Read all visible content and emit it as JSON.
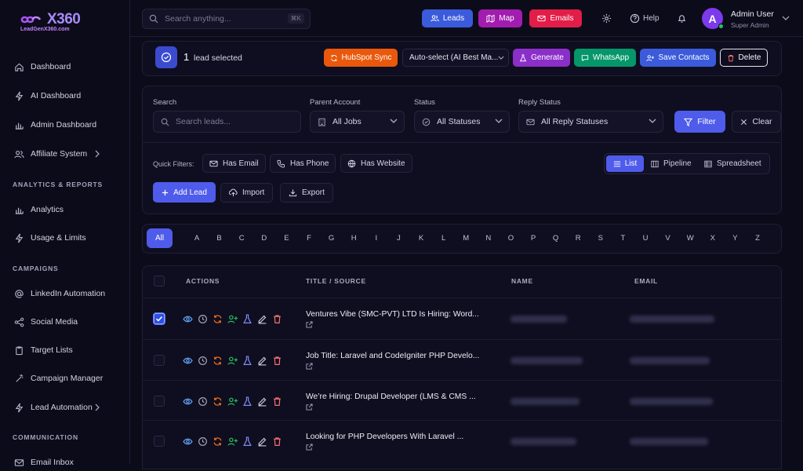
{
  "logo": {
    "wordmark": "X360",
    "subtitle": "LeadGenX360.com"
  },
  "sidebar": {
    "items_top": [
      {
        "label": "Dashboard",
        "icon": "home-icon"
      },
      {
        "label": "AI Dashboard",
        "icon": "sparkle-icon"
      },
      {
        "label": "Admin Dashboard",
        "icon": "bar-chart-icon"
      },
      {
        "label": "Affiliate System",
        "icon": "users-icon"
      }
    ],
    "section_analytics": "ANALYTICS & REPORTS",
    "items_analytics": [
      {
        "label": "Analytics",
        "icon": "bar-chart-icon"
      },
      {
        "label": "Usage & Limits",
        "icon": "bolt-icon"
      }
    ],
    "section_campaigns": "CAMPAIGNS",
    "items_campaigns": [
      {
        "label": "LinkedIn Automation",
        "icon": "at-icon"
      },
      {
        "label": "Social Media",
        "icon": "share-icon"
      },
      {
        "label": "Target Lists",
        "icon": "clipboard-icon"
      },
      {
        "label": "Campaign Manager",
        "icon": "wand-icon"
      },
      {
        "label": "Lead Automation",
        "icon": "bolt-icon"
      }
    ],
    "section_communication": "COMMUNICATION",
    "items_communication": [
      {
        "label": "Email Inbox",
        "icon": "mail-icon"
      }
    ]
  },
  "topbar": {
    "search_placeholder": "Search anything...",
    "shortcut": "⌘K",
    "leads": "Leads",
    "map": "Map",
    "emails": "Emails",
    "help": "Help",
    "user_name": "Admin User",
    "user_role": "Super Admin",
    "avatar_initial": "A"
  },
  "selection_bar": {
    "count": "1",
    "label": "lead selected",
    "hubspot": "HubSpot Sync",
    "auto_select": "Auto-select (AI Best Ma...",
    "generate": "Generate",
    "whatsapp": "WhatsApp",
    "save_contacts": "Save Contacts",
    "delete": "Delete"
  },
  "filters": {
    "search_label": "Search",
    "search_placeholder": "Search leads...",
    "parent_label": "Parent Account",
    "parent_value": "All Jobs",
    "status_label": "Status",
    "status_value": "All Statuses",
    "reply_label": "Reply Status",
    "reply_value": "All Reply Statuses",
    "filter_button": "Filter",
    "clear_button": "Clear",
    "quick_label": "Quick Filters:",
    "has_email": "Has Email",
    "has_phone": "Has Phone",
    "has_website": "Has Website",
    "view_list": "List",
    "view_pipeline": "Pipeline",
    "view_spreadsheet": "Spreadsheet",
    "add_lead": "Add Lead",
    "import": "Import",
    "export": "Export"
  },
  "alphabet": [
    "All",
    "A",
    "B",
    "C",
    "D",
    "E",
    "F",
    "G",
    "H",
    "I",
    "J",
    "K",
    "L",
    "M",
    "N",
    "O",
    "P",
    "Q",
    "R",
    "S",
    "T",
    "U",
    "V",
    "W",
    "X",
    "Y",
    "Z"
  ],
  "table": {
    "headers": {
      "actions": "ACTIONS",
      "title": "TITLE / SOURCE",
      "name": "NAME",
      "email": "EMAIL"
    },
    "rows": [
      {
        "title": "Ventures Vibe (SMC-PVT) LTD Is Hiring: Word...",
        "checked": true
      },
      {
        "title": "Job Title: Laravel and CodeIgniter PHP Develo...",
        "checked": false
      },
      {
        "title": "We’re Hiring: Drupal Developer (LMS & CMS ...",
        "checked": false
      },
      {
        "title": "Looking for PHP Developers With Laravel ...",
        "checked": false
      }
    ]
  },
  "colors": {
    "leads": "#3b5bdb",
    "map": "#a21caf",
    "emails": "#e11d48",
    "hubspot": "#ea580c",
    "generate": "#8b2fc9",
    "whatsapp": "#059669",
    "save": "#3b5bdb",
    "delete": "#f87171",
    "primary": "#4f5bea"
  }
}
